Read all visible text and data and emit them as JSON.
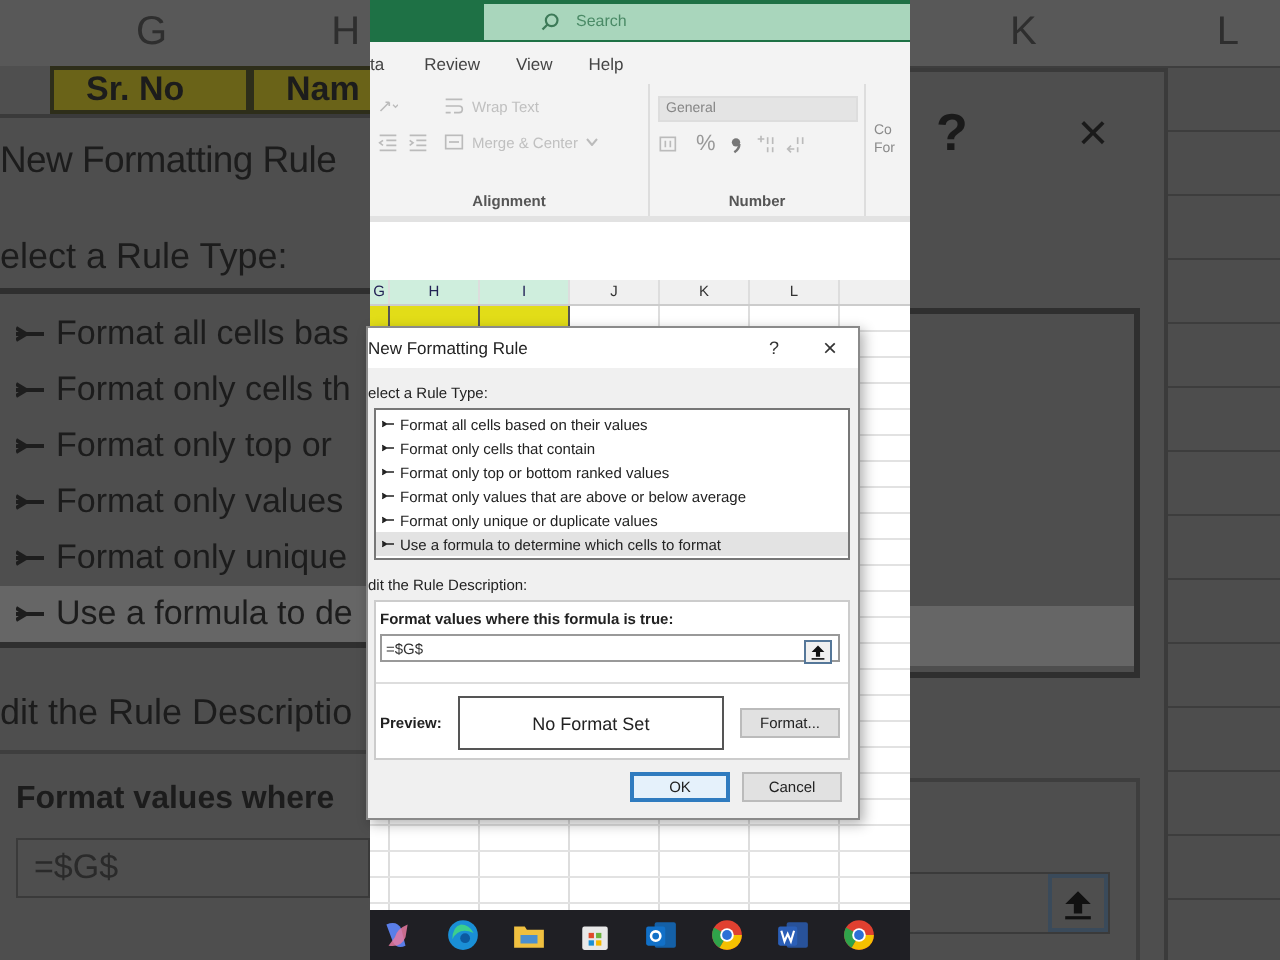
{
  "zoomed_backdrop": {
    "left": {
      "columns": [
        "G",
        "H"
      ],
      "cells": [
        "Sr. No",
        "Nam"
      ],
      "dialog_title": "New Formatting Rule",
      "rule_type_label": "elect a Rule Type:",
      "rule_types": [
        {
          "label": "Format all cells bas",
          "selected": false
        },
        {
          "label": "Format only cells th",
          "selected": false
        },
        {
          "label": "Format only top or",
          "selected": false
        },
        {
          "label": "Format only values",
          "selected": false
        },
        {
          "label": "Format only unique",
          "selected": false
        },
        {
          "label": "Use a formula to de",
          "selected": true
        }
      ],
      "description_label": "dit the Rule Descriptio",
      "formula_label": "Format values where",
      "formula": "=$G$"
    },
    "right": {
      "columns": [
        "K",
        "L"
      ],
      "help": "?",
      "close": "×"
    }
  },
  "excel": {
    "search": {
      "placeholder": "Search"
    },
    "tabs": [
      "ta",
      "Review",
      "View",
      "Help"
    ],
    "ribbon": {
      "groups": [
        {
          "kind": "alignment",
          "label": "Alignment",
          "items": [
            "Wrap Text",
            "Merge & Center"
          ]
        },
        {
          "kind": "number",
          "label": "Number",
          "format": "General",
          "symbol": "%"
        },
        {
          "kind": "styles",
          "lines": [
            "Co",
            "For"
          ]
        }
      ]
    },
    "columns": [
      {
        "label": "G",
        "highlighted": true
      },
      {
        "label": "H",
        "highlighted": true
      },
      {
        "label": "I",
        "highlighted": true
      },
      {
        "label": "J",
        "highlighted": false
      },
      {
        "label": "K",
        "highlighted": false
      },
      {
        "label": "L",
        "highlighted": false
      }
    ]
  },
  "dialog": {
    "title": "New Formatting Rule",
    "help": "?",
    "close": "×",
    "rule_type_label": "elect a Rule Type:",
    "rule_types": [
      {
        "label": "Format all cells based on their values",
        "selected": false
      },
      {
        "label": "Format only cells that contain",
        "selected": false
      },
      {
        "label": "Format only top or bottom ranked values",
        "selected": false
      },
      {
        "label": "Format only values that are above or below average",
        "selected": false
      },
      {
        "label": "Format only unique or duplicate values",
        "selected": false
      },
      {
        "label": "Use a formula to determine which cells to format",
        "selected": true
      }
    ],
    "description_label": "dit the Rule Description:",
    "formula_label": "Format values where this formula is true:",
    "formula": "=$G$",
    "preview_label": "Preview:",
    "preview": "No Format Set",
    "format_button": "Format...",
    "buttons": [
      {
        "label": "OK",
        "default": true
      },
      {
        "label": "Cancel",
        "default": false
      }
    ]
  },
  "taskbar": {
    "apps": [
      {
        "kind": "copilot"
      },
      {
        "kind": "edge"
      },
      {
        "kind": "folder"
      },
      {
        "kind": "store"
      },
      {
        "kind": "outlook"
      },
      {
        "kind": "chrome"
      },
      {
        "kind": "word"
      },
      {
        "kind": "chrome"
      }
    ]
  }
}
